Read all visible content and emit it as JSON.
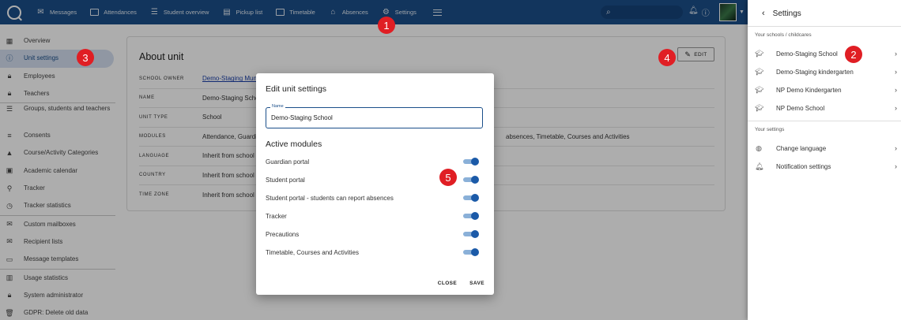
{
  "topbar": {
    "nav": [
      {
        "label": "Messages",
        "icon": "mail-icon"
      },
      {
        "label": "Attendances",
        "icon": "calendar-check-icon"
      },
      {
        "label": "Student overview",
        "icon": "list-icon"
      },
      {
        "label": "Pickup list",
        "icon": "clipboard-icon"
      },
      {
        "label": "Timetable",
        "icon": "calendar-icon"
      },
      {
        "label": "Absences",
        "icon": "home-icon"
      },
      {
        "label": "Settings",
        "icon": "gear-icon"
      }
    ]
  },
  "sidebar": {
    "items": [
      {
        "label": "Overview",
        "icon": "dashboard-icon"
      },
      {
        "label": "Unit settings",
        "icon": "info-icon",
        "active": true
      },
      {
        "label": "Employees",
        "icon": "lock-icon"
      },
      {
        "label": "Teachers",
        "icon": "lock-icon"
      },
      {
        "label": "Groups, students and teachers",
        "icon": "list-icon"
      },
      {
        "label": "Consents",
        "icon": "checklist-icon"
      },
      {
        "label": "Course/Activity Categories",
        "icon": "category-icon"
      },
      {
        "label": "Academic calendar",
        "icon": "calendar-icon"
      },
      {
        "label": "Tracker",
        "icon": "walk-icon"
      },
      {
        "label": "Tracker statistics",
        "icon": "timer-icon"
      },
      {
        "label": "Custom mailboxes",
        "icon": "mail-icon"
      },
      {
        "label": "Recipient lists",
        "icon": "mail-icon"
      },
      {
        "label": "Message templates",
        "icon": "message-icon"
      },
      {
        "label": "Usage statistics",
        "icon": "bar-chart-icon"
      },
      {
        "label": "System administrator",
        "icon": "lock-icon"
      },
      {
        "label": "GDPR: Delete old data",
        "icon": "trash-icon"
      }
    ]
  },
  "about": {
    "title": "About unit",
    "edit_label": "EDIT",
    "rows": [
      {
        "key": "SCHOOL OWNER",
        "value": "Demo-Staging Mun"
      },
      {
        "key": "NAME",
        "value": "Demo-Staging Scho"
      },
      {
        "key": "UNIT TYPE",
        "value": "School"
      },
      {
        "key": "MODULES",
        "value": "Attendance, Guardi",
        "value_tail": "absences, Timetable, Courses and Activities"
      },
      {
        "key": "LANGUAGE",
        "value": "Inherit from school"
      },
      {
        "key": "COUNTRY",
        "value": "Inherit from school"
      },
      {
        "key": "TIME ZONE",
        "value": "Inherit from school"
      }
    ]
  },
  "dialog": {
    "title": "Edit unit settings",
    "name_label": "Name",
    "name_value": "Demo-Staging School",
    "modules_title": "Active modules",
    "modules": [
      {
        "label": "Guardian portal",
        "on": true
      },
      {
        "label": "Student portal",
        "on": true
      },
      {
        "label": "Student portal - students can report absences",
        "on": true
      },
      {
        "label": "Tracker",
        "on": true
      },
      {
        "label": "Precautions",
        "on": true
      },
      {
        "label": "Timetable, Courses and Activities",
        "on": true
      }
    ],
    "close_label": "CLOSE",
    "save_label": "SAVE"
  },
  "rpanel": {
    "title": "Settings",
    "schools_heading": "Your schools / childcares",
    "schools": [
      {
        "label": "Demo-Staging School"
      },
      {
        "label": "Demo-Staging kindergarten"
      },
      {
        "label": "NP Demo Kindergarten"
      },
      {
        "label": "NP Demo School"
      }
    ],
    "settings_heading": "Your settings",
    "settings": [
      {
        "label": "Change language",
        "icon": "globe-icon"
      },
      {
        "label": "Notification settings",
        "icon": "bell-icon"
      }
    ]
  },
  "badges": [
    "1",
    "2",
    "3",
    "4",
    "5"
  ],
  "colors": {
    "topbar": "#1b4f8a",
    "accent": "#1b5aa8",
    "badge": "#e01e24"
  }
}
